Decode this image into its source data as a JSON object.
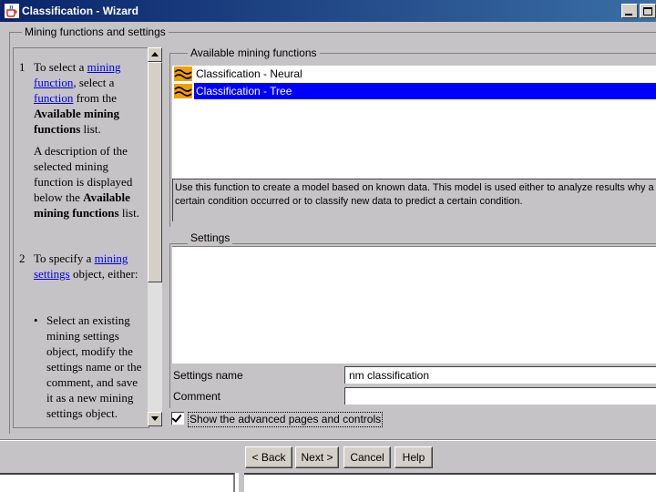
{
  "window": {
    "title": "Classification - Wizard",
    "icon": "java-cup-icon"
  },
  "main_group": {
    "label": "Mining functions and settings"
  },
  "help": {
    "step1_num": "1",
    "step1_a": "To select a ",
    "step1_link1": "mining function",
    "step1_b": ", select a ",
    "step1_link2": "function",
    "step1_c": " from the ",
    "step1_bold": "Available mining functions",
    "step1_d": " list.",
    "step1_desc_a": "A description of the selected mining function is displayed below the ",
    "step1_desc_bold": "Available mining functions",
    "step1_desc_b": " list.",
    "step2_num": "2",
    "step2_a": "To specify a ",
    "step2_link": "mining settings",
    "step2_b": " object, either:",
    "bullet": "•",
    "bullet1": "Select an existing mining settings object, modify the settings name or the comment, and save it as a new mining settings object."
  },
  "functions": {
    "label": "Available mining functions",
    "items": [
      {
        "label": "Classification - Neural",
        "selected": false
      },
      {
        "label": "Classification - Tree",
        "selected": true
      }
    ],
    "description": "Use this function to create a model based on known data. This model is used either to analyze results why a certain condition occurred or to classify new data to predict a certain condition."
  },
  "settings": {
    "label": "Settings",
    "name_label": "Settings name",
    "name_value": "nm classification",
    "comment_label": "Comment",
    "comment_value": "",
    "advanced_label": "Show the advanced pages and controls",
    "advanced_checked": true
  },
  "buttons": {
    "back": "< Back",
    "next": "Next >",
    "cancel": "Cancel",
    "help": "Help"
  },
  "colors": {
    "selection": "#0000ff",
    "titlebar": "#0a246a",
    "link": "#0000ee"
  }
}
